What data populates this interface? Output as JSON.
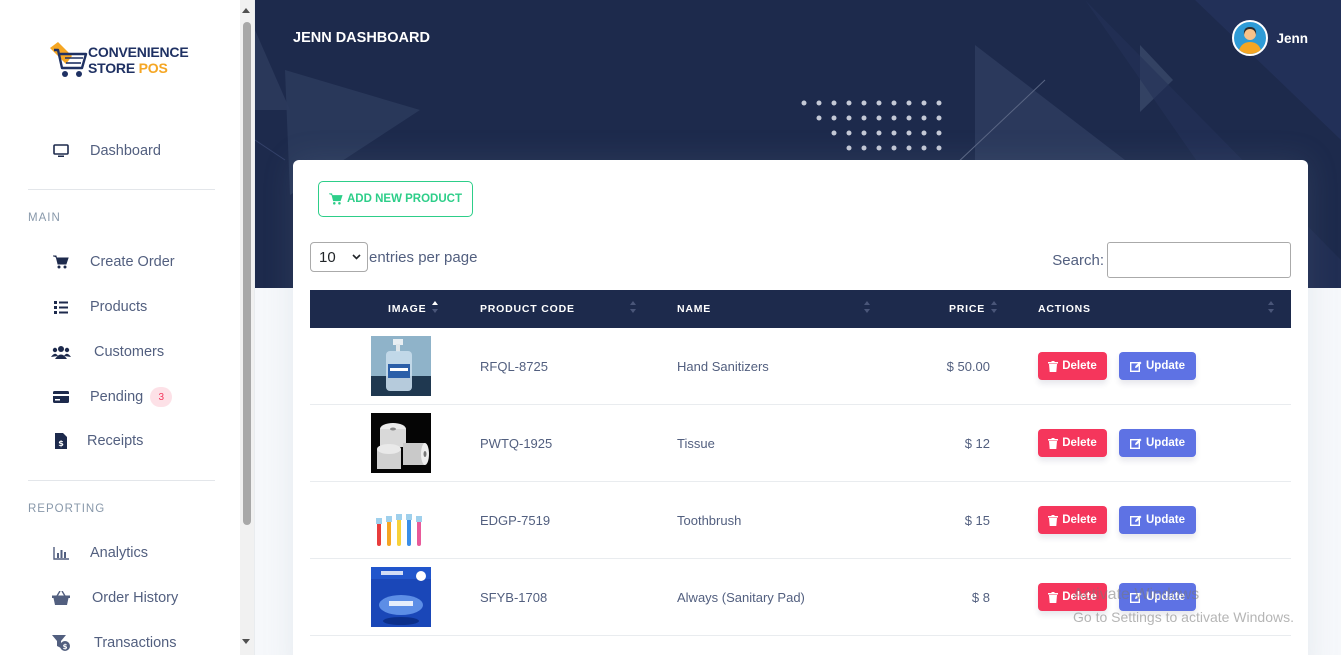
{
  "brand": {
    "line1": "CONVENIENCE",
    "line2a": "STORE ",
    "line2b": "POS"
  },
  "sidebar": {
    "dashboard": "Dashboard",
    "main_heading": "MAIN",
    "items_main": [
      {
        "label": "Create Order",
        "icon": "cart-icon"
      },
      {
        "label": "Products",
        "icon": "list-icon"
      },
      {
        "label": "Customers",
        "icon": "users-icon"
      },
      {
        "label": "Pending",
        "icon": "card-icon",
        "badge": "3"
      },
      {
        "label": "Receipts",
        "icon": "invoice-icon"
      }
    ],
    "reporting_heading": "REPORTING",
    "items_reporting": [
      {
        "label": "Analytics",
        "icon": "chart-icon"
      },
      {
        "label": "Order History",
        "icon": "basket-icon"
      },
      {
        "label": "Transactions",
        "icon": "filter-dollar-icon"
      }
    ]
  },
  "header": {
    "title": "JENN DASHBOARD",
    "user": "Jenn"
  },
  "toolbar": {
    "add_label": "ADD NEW PRODUCT",
    "entries_value": "10",
    "entries_label": "entries per page",
    "search_label": "Search:",
    "search_value": ""
  },
  "table": {
    "columns": [
      "IMAGE",
      "PRODUCT CODE",
      "NAME",
      "PRICE",
      "ACTIONS"
    ],
    "rows": [
      {
        "code": "RFQL-8725",
        "name": "Hand Sanitizers",
        "price": "$ 50.00",
        "image": "hand-sanitizer-image"
      },
      {
        "code": "PWTQ-1925",
        "name": "Tissue",
        "price": "$ 12",
        "image": "tissue-image"
      },
      {
        "code": "EDGP-7519",
        "name": "Toothbrush",
        "price": "$ 15",
        "image": "toothbrush-image"
      },
      {
        "code": "SFYB-1708",
        "name": "Always (Sanitary Pad)",
        "price": "$ 8",
        "image": "sanitary-pad-image"
      }
    ],
    "delete_label": "Delete",
    "update_label": "Update"
  },
  "watermark": {
    "line1": "Activate Windows",
    "line2": "Go to Settings to activate Windows."
  },
  "colors": {
    "navy": "#1d2a4c",
    "green": "#2dce89",
    "red": "#f5365c",
    "blue": "#5e72e4",
    "gold": "#f5a623"
  }
}
